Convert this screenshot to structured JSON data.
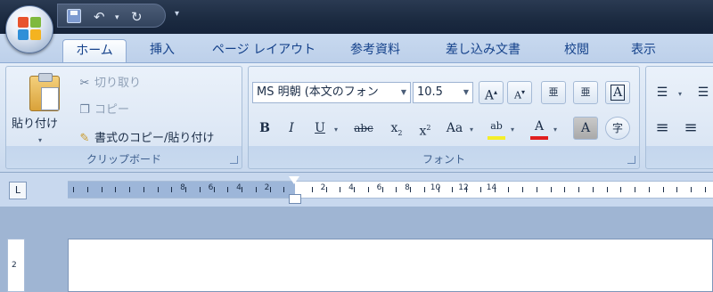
{
  "quick_access": {
    "undo_glyph": "↶",
    "undo_dropdown_glyph": "▾",
    "redo_glyph": "↻",
    "customize_glyph": "▾"
  },
  "tabs": [
    {
      "label": "ホーム",
      "active": true
    },
    {
      "label": "挿入"
    },
    {
      "label": "ページ レイアウト"
    },
    {
      "label": "参考資料"
    },
    {
      "label": "差し込み文書"
    },
    {
      "label": "校閲"
    },
    {
      "label": "表示"
    }
  ],
  "clipboard": {
    "paste_label": "貼り付け",
    "cut_label": "切り取り",
    "copy_label": "コピー",
    "format_painter_label": "書式のコピー/貼り付け",
    "group_label": "クリップボード",
    "paste_caret": "▾"
  },
  "font": {
    "font_name": "MS 明朝 (本文のフォン",
    "font_size": "10.5",
    "grow_label": "A",
    "shrink_label": "A",
    "bold_label": "B",
    "italic_label": "I",
    "underline_label": "U",
    "strike_label": "abc",
    "subscript_label": "x",
    "superscript_label": "x",
    "change_case_label": "Aa",
    "char_shading_label": "A",
    "enclose_label": "字",
    "border_label": "A",
    "font_color_label": "A",
    "highlight_label": "ab",
    "phonetic_label": "亜",
    "clear_label": "亜",
    "group_label": "フォント",
    "sub_mark": "2",
    "sup_mark": "2"
  },
  "paragraph": {
    "bullets_glyph": "☰",
    "align_left_glyph": "≡",
    "center_glyph": "≡"
  },
  "ruler": {
    "tab_selector": "L",
    "left_numbers": [
      "8",
      "6",
      "4",
      "2"
    ],
    "right_numbers": [
      "2",
      "4",
      "6",
      "8",
      "10",
      "12",
      "14"
    ]
  },
  "vertical_ruler": {
    "mark": "2"
  },
  "colors": {
    "highlight": "#f4ee2a",
    "font_color": "#e01e1e",
    "accent": "#15428b"
  }
}
